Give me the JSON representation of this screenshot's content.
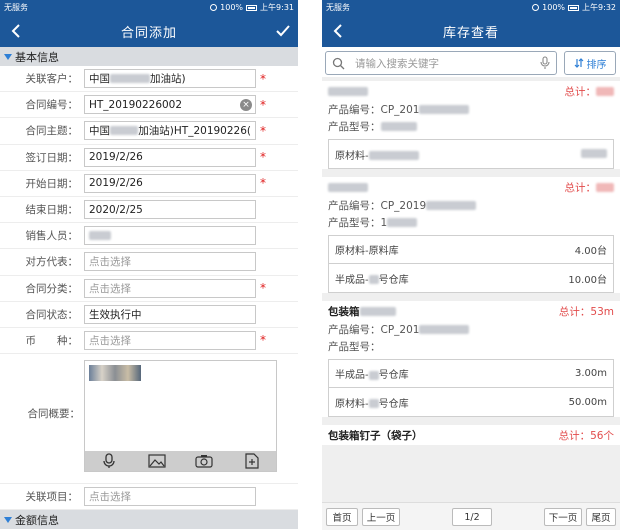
{
  "left": {
    "status": {
      "carrier": "无服务",
      "battery": "100%",
      "time": "上午9:31"
    },
    "nav": {
      "title": "合同添加"
    },
    "section_basic": "基本信息",
    "fields": [
      {
        "label": "关联客户：",
        "value": "中国",
        "value_suffix": "加油站)",
        "blurred": true,
        "placeholder": false,
        "required": true
      },
      {
        "label": "合同编号：",
        "value": "HT_20190226002",
        "placeholder": false,
        "required": true,
        "clearable": true
      },
      {
        "label": "合同主题：",
        "value": "中国",
        "value_suffix": "加油站)HT_20190226(",
        "blurred": true,
        "placeholder": false,
        "required": true
      },
      {
        "label": "签订日期：",
        "value": "2019/2/26",
        "placeholder": false,
        "required": true
      },
      {
        "label": "开始日期：",
        "value": "2019/2/26",
        "placeholder": false,
        "required": true
      },
      {
        "label": "结束日期：",
        "value": "2020/2/25",
        "placeholder": false,
        "required": false
      },
      {
        "label": "销售人员：",
        "value": "",
        "blurred_only": true,
        "placeholder": false,
        "required": false
      },
      {
        "label": "对方代表：",
        "value": "点击选择",
        "placeholder": true,
        "required": false
      },
      {
        "label": "合同分类：",
        "value": "点击选择",
        "placeholder": true,
        "required": true
      },
      {
        "label": "合同状态：",
        "value": "生效执行中",
        "placeholder": false,
        "required": false
      },
      {
        "label": "币　　种：",
        "value": "点击选择",
        "placeholder": true,
        "required": true
      }
    ],
    "summary_label": "合同概要：",
    "related_label": "关联项目：",
    "related_value": "点击选择",
    "section_amount": "金额信息",
    "colors": {
      "primary": "#1c5799",
      "required": "#e02020",
      "section_bg": "#d9dce0"
    }
  },
  "right": {
    "status": {
      "carrier": "无服务",
      "battery": "100%",
      "time": "上午9:32"
    },
    "nav": {
      "title": "库存查看"
    },
    "search": {
      "placeholder": "请输入搜索关键字",
      "sort_label": "排序"
    },
    "cards": [
      {
        "name": "",
        "name_blurred": true,
        "total_label": "总计：",
        "code_label": "产品编号：",
        "code": "CP_201",
        "model_label": "产品型号：",
        "model": "",
        "stocks": [
          {
            "location": "原材料-",
            "qty": ""
          }
        ]
      },
      {
        "name": "",
        "name_blurred": true,
        "total_label": "总计：",
        "code_label": "产品编号：",
        "code": "CP_2019",
        "model_label": "产品型号：",
        "model": "1",
        "stocks": [
          {
            "location": "原材料-原料库",
            "qty": "4.00台"
          },
          {
            "location": "半成品-",
            "location_suffix": "号仓库",
            "qty": "10.00台"
          }
        ]
      },
      {
        "name": "包装箱",
        "name_blurred": true,
        "total_label": "总计：",
        "total": "53m",
        "code_label": "产品编号：",
        "code": "CP_201",
        "model_label": "产品型号：",
        "model": "",
        "stocks": [
          {
            "location": "半成品-",
            "location_suffix": "号仓库",
            "qty": "3.00m"
          },
          {
            "location": "原材料-",
            "location_suffix": "号仓库",
            "qty": "50.00m"
          }
        ]
      },
      {
        "name": "包装箱钉子（袋子）",
        "name_blurred": false,
        "total_label": "总计：",
        "total": "56个"
      }
    ],
    "pager": {
      "first": "首页",
      "prev": "上一页",
      "page": "1/2",
      "next": "下一页",
      "last": "尾页"
    },
    "colors": {
      "total": "#e24b4b",
      "sort": "#2e7fd6"
    }
  }
}
